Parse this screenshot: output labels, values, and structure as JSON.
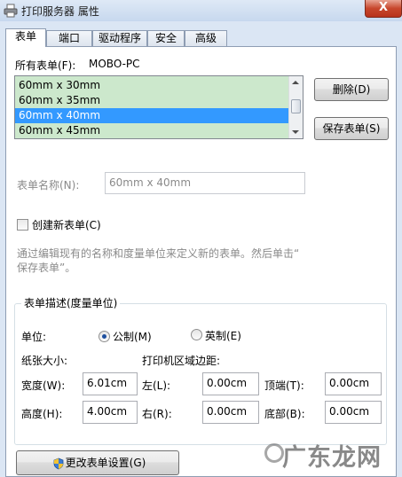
{
  "window": {
    "title": "打印服务器 属性",
    "close_glyph": "X"
  },
  "tabs": [
    "表单",
    "端口",
    "驱动程序",
    "安全",
    "高级"
  ],
  "forms": {
    "all_forms_label": "所有表单(F):",
    "server_name": "MOBO-PC",
    "items": [
      "60mm x 30mm",
      "60mm x 35mm",
      "60mm x 40mm",
      "60mm x 45mm"
    ],
    "selected": "60mm x 40mm",
    "delete_button": "删除(D)",
    "save_button": "保存表单(S)"
  },
  "form_name": {
    "label": "表单名称(N):",
    "value": "60mm x 40mm"
  },
  "create_new": {
    "label": "创建新表单(C)",
    "checked": false,
    "hint_line1": "通过编辑现有的名称和度量单位来定义新的表单。然后单击“",
    "hint_line2": "保存表单”。"
  },
  "description": {
    "legend": "表单描述(度量单位)",
    "unit_label": "单位:",
    "metric_label": "公制(M)",
    "english_label": "英制(E)",
    "selected_unit": "metric",
    "paper_size_label": "纸张大小:",
    "margins_label": "打印机区域边距:",
    "width_label": "宽度(W):",
    "width_value": "6.01cm",
    "height_label": "高度(H):",
    "height_value": "4.00cm",
    "left_label": "左(L):",
    "left_value": "0.00cm",
    "right_label": "右(R):",
    "right_value": "0.00cm",
    "top_label": "顶端(T):",
    "top_value": "0.00cm",
    "bottom_label": "底部(B):",
    "bottom_value": "0.00cm"
  },
  "change_settings_button": "更改表单设置(G)",
  "watermark": "广东龙网"
}
